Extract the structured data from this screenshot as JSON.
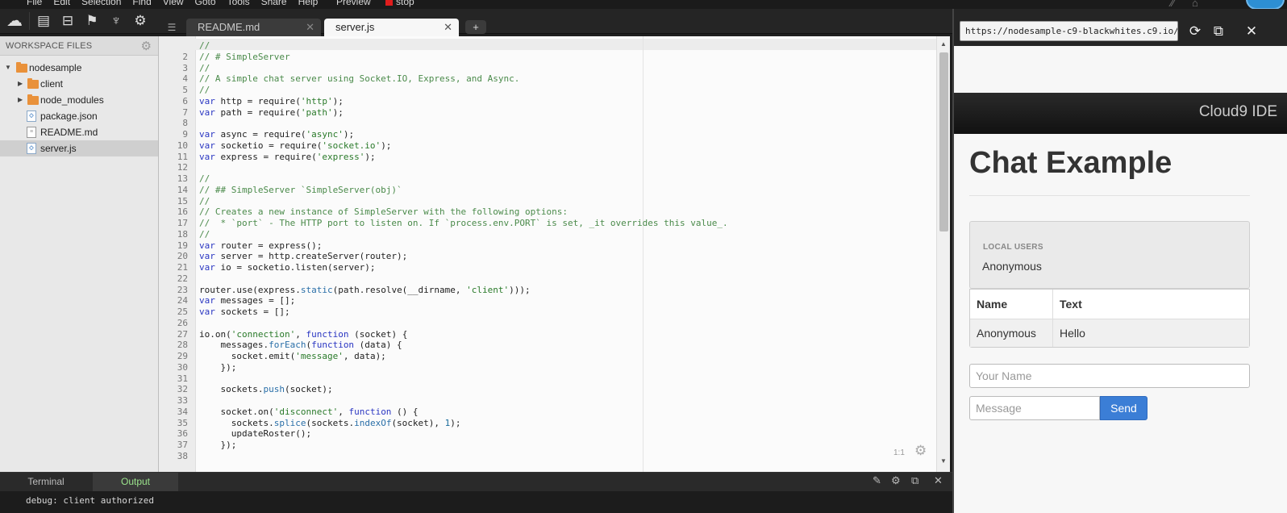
{
  "menu": {
    "items": [
      "File",
      "Edit",
      "Selection",
      "Find",
      "View",
      "Goto",
      "Tools",
      "Share",
      "Help"
    ],
    "preview": "Preview",
    "stop": "stop"
  },
  "tabs": [
    {
      "label": "README.md",
      "active": false
    },
    {
      "label": "server.js",
      "active": true
    }
  ],
  "add_tab": "+",
  "sidebar": {
    "title": "WORKSPACE FILES",
    "tree": [
      {
        "label": "nodesample",
        "type": "folder",
        "expanded": true
      },
      {
        "label": "client",
        "type": "folder",
        "expanded": false
      },
      {
        "label": "node_modules",
        "type": "folder",
        "expanded": false
      },
      {
        "label": "package.json",
        "type": "file"
      },
      {
        "label": "README.md",
        "type": "file"
      },
      {
        "label": "server.js",
        "type": "file",
        "selected": true
      }
    ]
  },
  "editor": {
    "cursor": "1:1",
    "lines": [
      "//",
      "// # SimpleServer",
      "//",
      "// A simple chat server using Socket.IO, Express, and Async.",
      "//",
      "var http = require('http');",
      "var path = require('path');",
      "",
      "var async = require('async');",
      "var socketio = require('socket.io');",
      "var express = require('express');",
      "",
      "//",
      "// ## SimpleServer `SimpleServer(obj)`",
      "//",
      "// Creates a new instance of SimpleServer with the following options:",
      "//  * `port` - The HTTP port to listen on. If `process.env.PORT` is set, _it overrides this value_.",
      "//",
      "var router = express();",
      "var server = http.createServer(router);",
      "var io = socketio.listen(server);",
      "",
      "router.use(express.static(path.resolve(__dirname, 'client')));",
      "var messages = [];",
      "var sockets = [];",
      "",
      "io.on('connection', function (socket) {",
      "    messages.forEach(function (data) {",
      "      socket.emit('message', data);",
      "    });",
      "",
      "    sockets.push(socket);",
      "",
      "    socket.on('disconnect', function () {",
      "      sockets.splice(sockets.indexOf(socket), 1);",
      "      updateRoster();",
      "    });",
      ""
    ]
  },
  "bottom_panel": {
    "tabs": [
      "Terminal",
      "Output"
    ],
    "active_tab": "Output",
    "output": "debug: client authorized"
  },
  "preview": {
    "url": "https://nodesample-c9-blackwhites.c9.io/",
    "brand": "Cloud9 IDE",
    "title": "Chat Example",
    "users_heading": "LOCAL USERS",
    "users": [
      "Anonymous"
    ],
    "table": {
      "headers": [
        "Name",
        "Text"
      ],
      "rows": [
        [
          "Anonymous",
          "Hello"
        ]
      ]
    },
    "name_placeholder": "Your Name",
    "message_placeholder": "Message",
    "send_label": "Send"
  },
  "colors": {
    "accent_send": "#3b7ed6",
    "stop_red": "#e01d1d",
    "output_tab_text": "#9be38c",
    "folder": "#e9913a"
  }
}
